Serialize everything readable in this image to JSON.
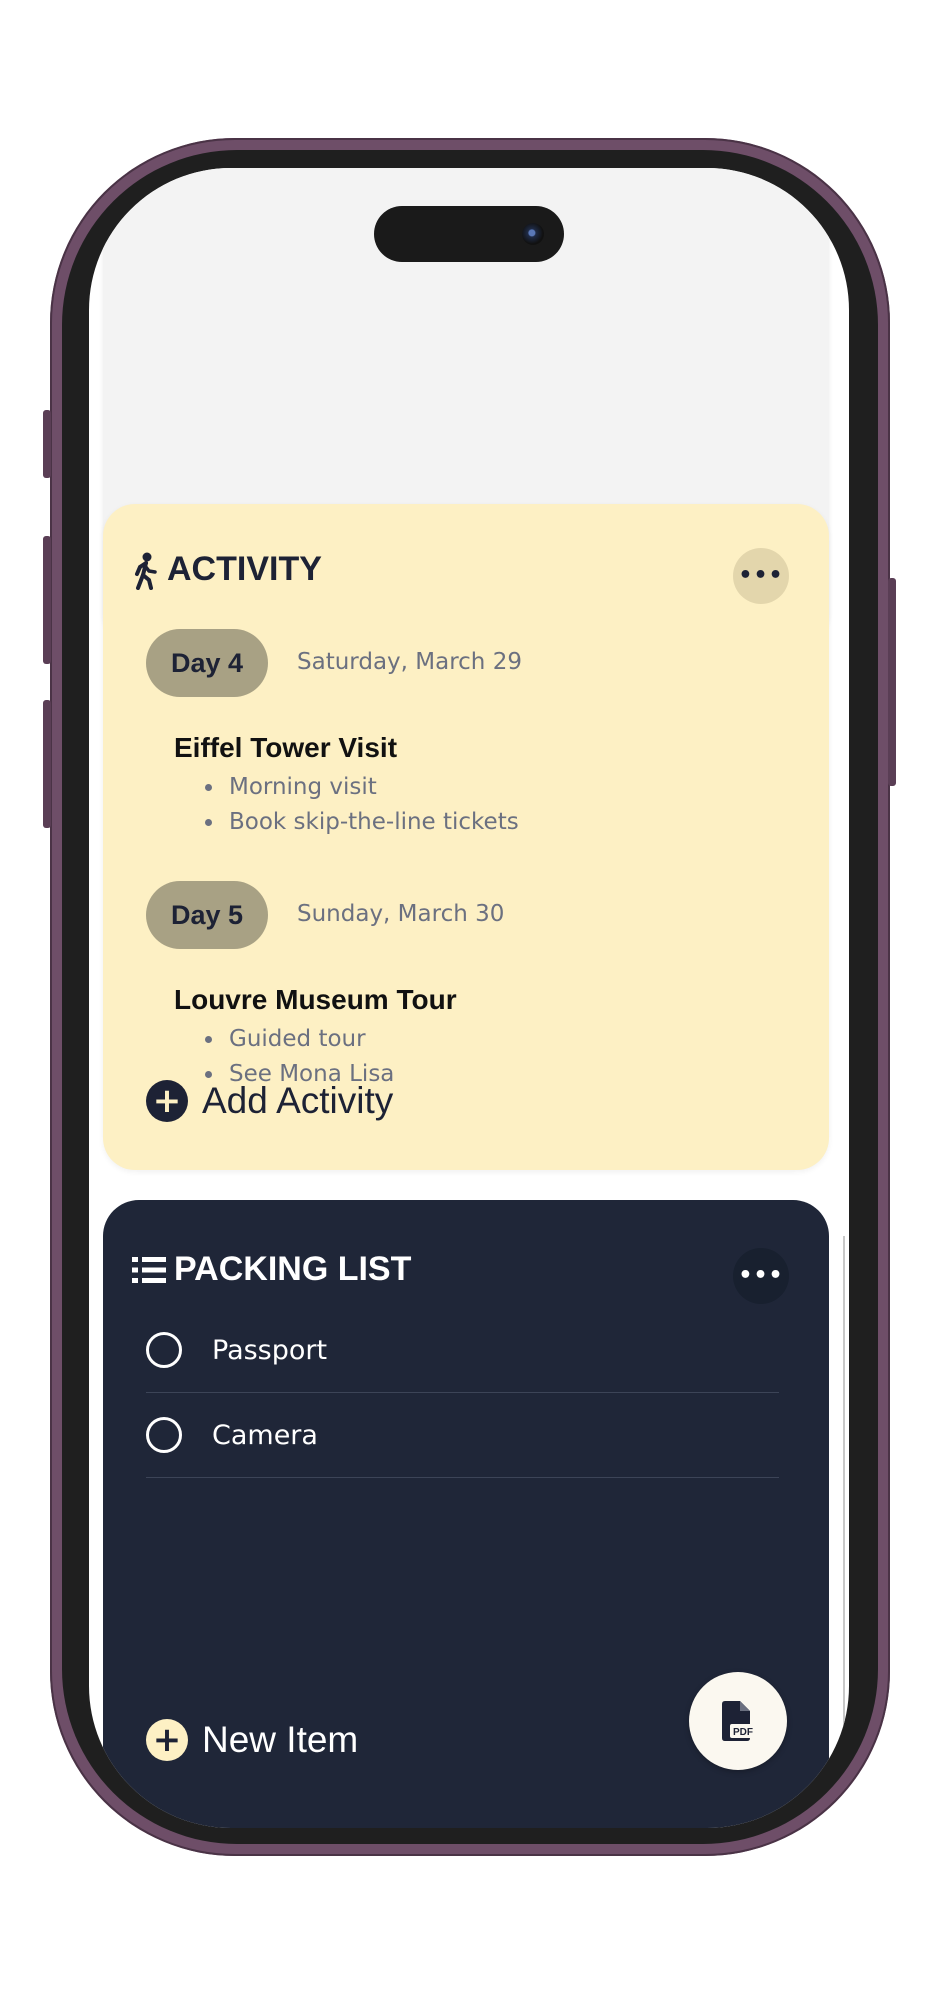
{
  "activity": {
    "title": "ACTIVITY",
    "icon": "walking-person-icon",
    "more_icon": "more-horizontal-icon",
    "days": [
      {
        "label": "Day 4",
        "date": "Saturday, March 29",
        "activity_name": "Eiffel Tower Visit",
        "notes": [
          "Morning visit",
          "Book skip-the-line tickets"
        ]
      },
      {
        "label": "Day 5",
        "date": "Sunday, March 30",
        "activity_name": "Louvre Museum Tour",
        "notes": [
          "Guided tour",
          "See Mona Lisa"
        ]
      }
    ],
    "add_label": "Add Activity",
    "background_color": "#fdf0c4"
  },
  "packing_list": {
    "title": "PACKING LIST",
    "icon": "list-icon",
    "more_icon": "more-horizontal-icon",
    "items": [
      {
        "label": "Passport",
        "checked": false
      },
      {
        "label": "Camera",
        "checked": false
      }
    ],
    "new_item_label": "New Item",
    "pdf_icon": "pdf-file-icon",
    "background_color": "#1f2638"
  },
  "colors": {
    "frame": "#6e4e68",
    "day_pill": "#a8a184",
    "accent_dark": "#1d2235"
  }
}
